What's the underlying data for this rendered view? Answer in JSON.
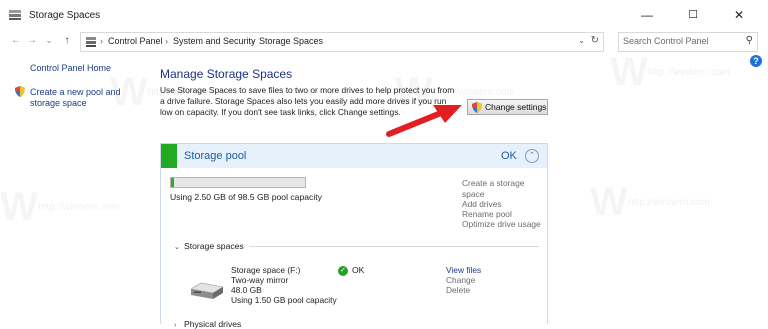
{
  "window": {
    "title": "Storage Spaces",
    "icon": "drive-stack-icon",
    "controls": {
      "minimize": "—",
      "maximize": "☐",
      "close": "✕"
    }
  },
  "nav": {
    "back": "←",
    "forward": "→",
    "dropdown": "⌄",
    "up": "↑"
  },
  "breadcrumb": {
    "items": [
      "Control Panel",
      "System and Security",
      "Storage Spaces"
    ],
    "separator": "›",
    "dropdown": "⌄",
    "refresh": "↻"
  },
  "search": {
    "placeholder": "Search Control Panel",
    "value": "",
    "icon": "search-icon"
  },
  "help": {
    "label": "?"
  },
  "sidebar": {
    "home_link": "Control Panel Home",
    "create_link": "Create a new pool and storage space"
  },
  "main": {
    "heading": "Manage Storage Spaces",
    "description": "Use Storage Spaces to save files to two or more drives to help protect you from a drive failure. Storage Spaces also lets you easily add more drives if you run low on capacity. If you don't see task links, click Change settings.",
    "change_settings_label": "Change settings"
  },
  "pool": {
    "name": "Storage pool",
    "status": "OK",
    "collapse": "⌃",
    "usage_fraction": 0.025,
    "usage_text": "Using 2.50 GB of 98.5 GB pool capacity",
    "links": [
      "Create a storage space",
      "Add drives",
      "Rename pool",
      "Optimize drive usage"
    ],
    "section_storage_spaces": "Storage spaces",
    "section_physical_drives": "Physical drives",
    "space": {
      "name": "Storage space (F:)",
      "resiliency": "Two-way mirror",
      "size": "48.0 GB",
      "usage": "Using 1.50 GB pool capacity",
      "status": "OK",
      "links": [
        "View files",
        "Change",
        "Delete"
      ]
    }
  },
  "watermark": "http://winaero.com",
  "colors": {
    "accent": "#1e3287",
    "link": "#1e3b8a",
    "pool_green": "#22aa22",
    "pool_header": "#e6f1fb",
    "arrow": "#e31e1e"
  }
}
